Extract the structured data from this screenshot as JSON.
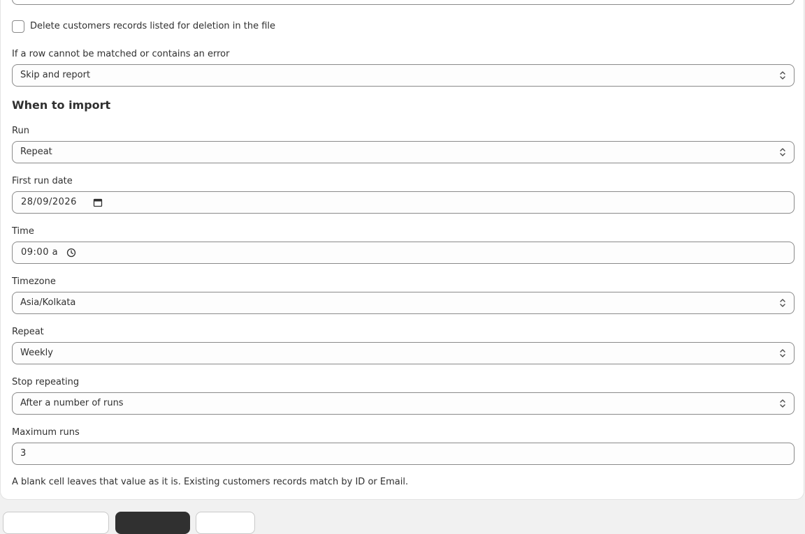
{
  "delete_option": {
    "label": "Delete customers records listed for deletion in the file",
    "checked": false
  },
  "error_handling": {
    "label": "If a row cannot be matched or contains an error",
    "value": "Skip and report"
  },
  "schedule": {
    "title": "When to import",
    "run": {
      "label": "Run",
      "value": "Repeat"
    },
    "first_run_date": {
      "label": "First run date",
      "value": "28/09/2026"
    },
    "time": {
      "label": "Time",
      "value": "09:00 a"
    },
    "timezone": {
      "label": "Timezone",
      "value": "Asia/Kolkata"
    },
    "repeat": {
      "label": "Repeat",
      "value": "Weekly"
    },
    "stop_repeating": {
      "label": "Stop repeating",
      "value": "After a number of runs"
    },
    "maximum_runs": {
      "label": "Maximum runs",
      "value": "3"
    }
  },
  "footnote": "A blank cell leaves that value as it is. Existing customers records match by ID or Email.",
  "icons": {
    "select": "select-chevron-icon",
    "calendar": "calendar-icon",
    "clock": "clock-icon"
  },
  "colors": {
    "border": "#8a8a8a",
    "text": "#303030",
    "background": "#f1f1f1",
    "card": "#ffffff",
    "primary_button": "#303030"
  }
}
